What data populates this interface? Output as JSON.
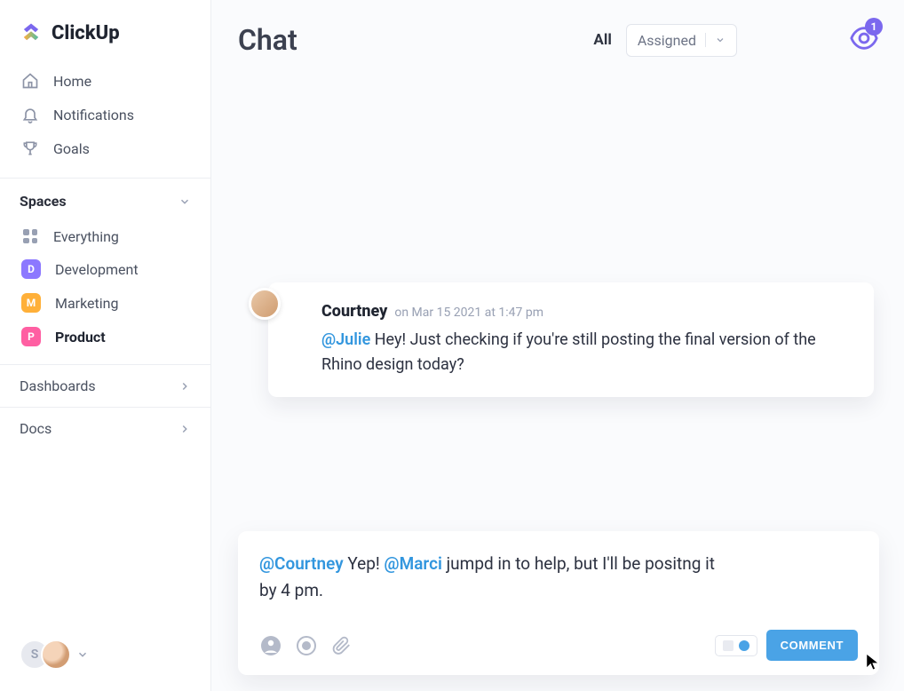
{
  "brand": {
    "name": "ClickUp"
  },
  "nav": {
    "home": "Home",
    "notifications": "Notifications",
    "goals": "Goals"
  },
  "spaces": {
    "header": "Spaces",
    "everything": "Everything",
    "items": [
      {
        "label": "Development",
        "initial": "D",
        "color": "#8c78ff"
      },
      {
        "label": "Marketing",
        "initial": "M",
        "color": "#ffb039"
      },
      {
        "label": "Product",
        "initial": "P",
        "color": "#ff5fa2"
      }
    ]
  },
  "sidelinks": {
    "dashboards": "Dashboards",
    "docs": "Docs"
  },
  "footer": {
    "initial": "S"
  },
  "header": {
    "title": "Chat",
    "tab_all": "All",
    "dropdown_label": "Assigned",
    "watch_count": "1"
  },
  "message": {
    "author": "Courtney",
    "meta": "on Mar 15 2021 at 1:47 pm",
    "mention": "@Julie",
    "body_rest": " Hey! Just checking if you're still posting the final version of the Rhino design today?"
  },
  "composer": {
    "mention1": "@Courtney",
    "mid1": " Yep! ",
    "mention2": "@Marci",
    "mid2": " jumpd in to help, but I'll be positng it by 4 pm.",
    "button": "COMMENT"
  }
}
